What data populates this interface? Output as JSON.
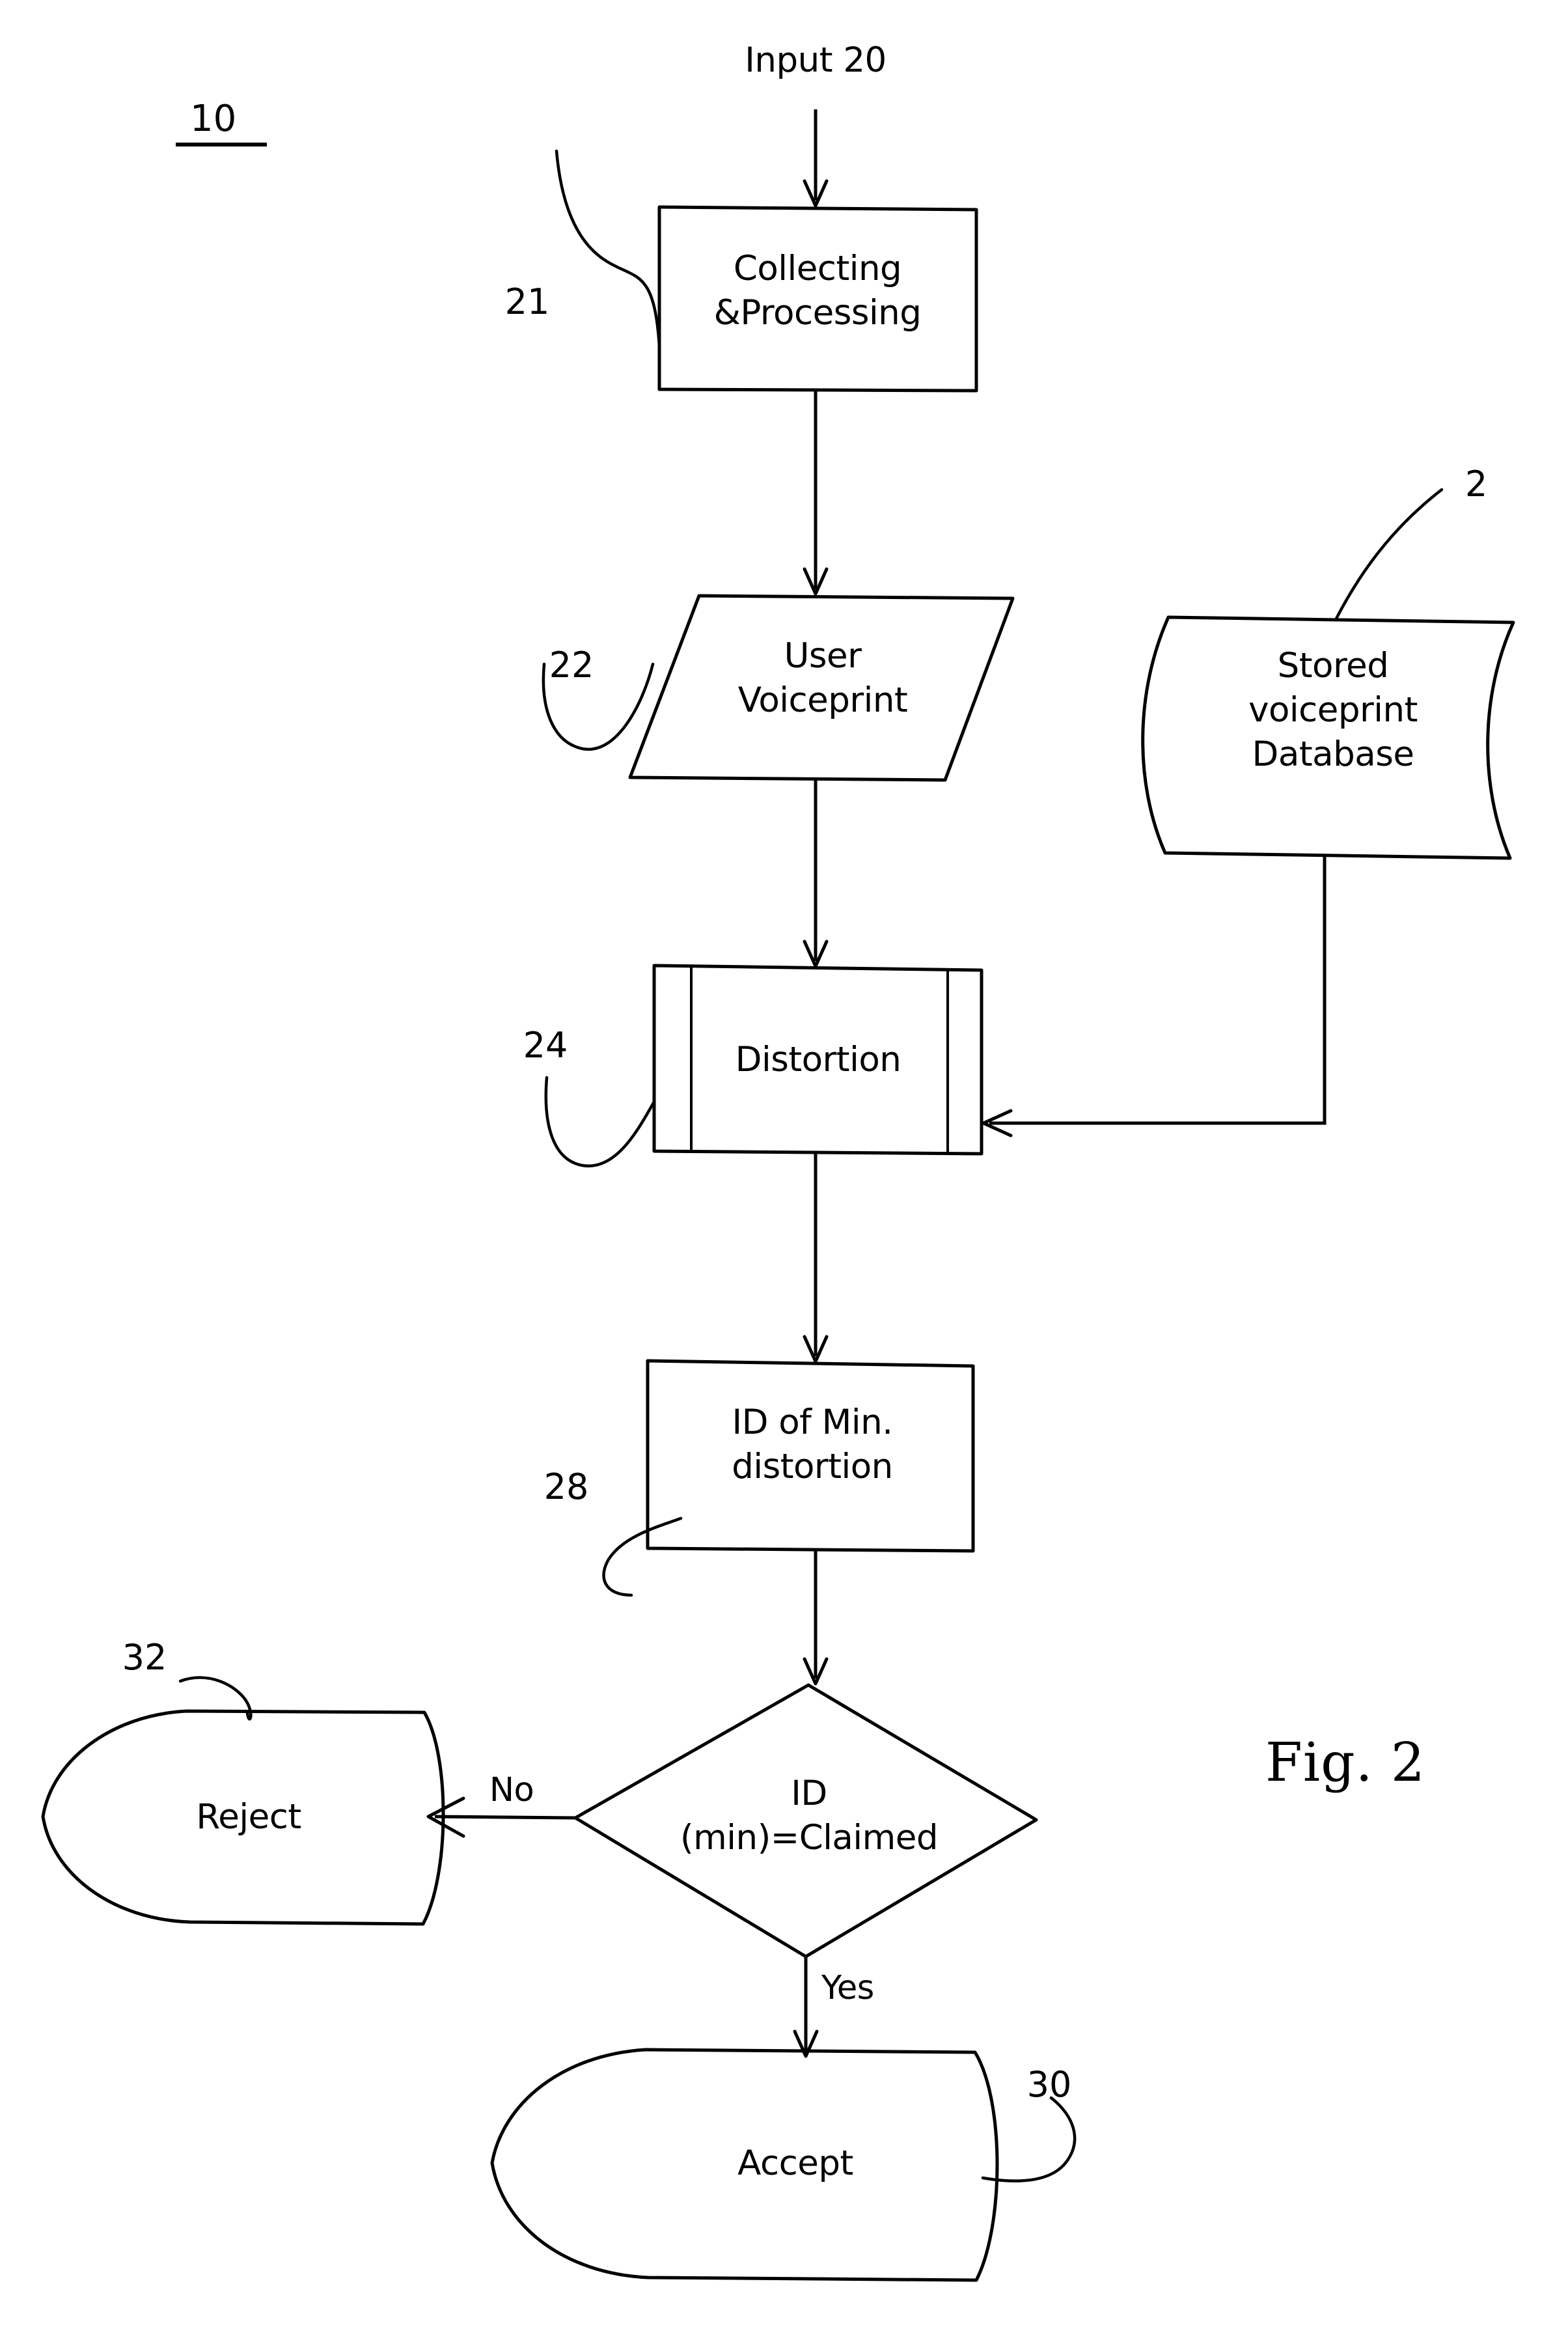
{
  "figure": {
    "caption": "Fig. 2",
    "assembly_number": "10",
    "input_label": "Input 20"
  },
  "nodes": {
    "collecting": {
      "ref": "21",
      "line1": "Collecting",
      "line2": "&Processing",
      "shape": "process-rectangle"
    },
    "user_voiceprint": {
      "ref": "22",
      "line1": "User",
      "line2": "Voiceprint",
      "shape": "data-parallelogram"
    },
    "stored_db": {
      "ref": "2",
      "line1": "Stored",
      "line2": "voiceprint",
      "line3": "Database",
      "shape": "stored-data"
    },
    "distortion": {
      "ref": "24",
      "line1": "Distortion",
      "shape": "predefined-process"
    },
    "id_min_distortion": {
      "ref": "28",
      "line1": "ID of Min.",
      "line2": "distortion",
      "shape": "process-rectangle"
    },
    "decision": {
      "line1": "ID",
      "line2": "(min)=Claimed",
      "shape": "decision-diamond"
    },
    "reject": {
      "ref": "32",
      "line1": "Reject",
      "shape": "terminator"
    },
    "accept": {
      "ref": "30",
      "line1": "Accept",
      "shape": "terminator"
    }
  },
  "edges": {
    "no_branch": "No",
    "yes_branch": "Yes"
  },
  "colors": {
    "ink": "#000000",
    "paper": "#ffffff"
  }
}
